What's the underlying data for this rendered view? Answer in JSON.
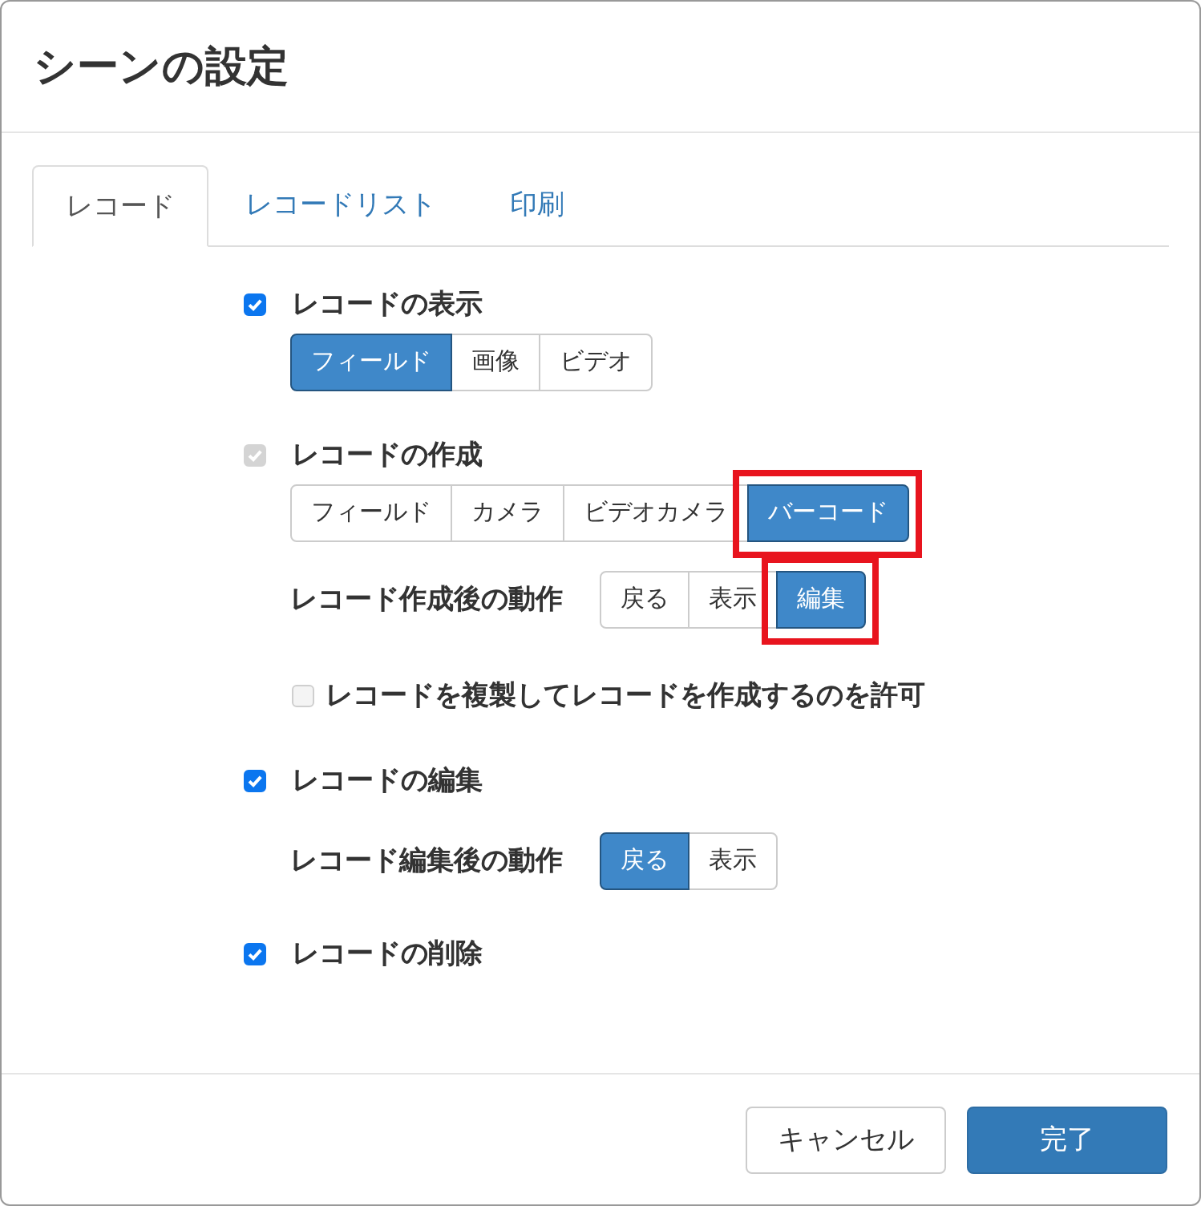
{
  "dialog": {
    "title": "シーンの設定"
  },
  "tabs": [
    {
      "label": "レコード",
      "selected": true
    },
    {
      "label": "レコードリスト",
      "selected": false
    },
    {
      "label": "印刷",
      "selected": false
    }
  ],
  "rows": [
    {
      "kind": "checkbox",
      "label": "レコードの表示",
      "checked": true,
      "disabled": false
    },
    {
      "kind": "buttons",
      "options": [
        {
          "label": "フィールド",
          "selected": true,
          "highlighted": false
        },
        {
          "label": "画像",
          "selected": false,
          "highlighted": false
        },
        {
          "label": "ビデオ",
          "selected": false,
          "highlighted": false
        }
      ]
    },
    {
      "kind": "checkbox",
      "label": "レコードの作成",
      "checked": true,
      "disabled": true
    },
    {
      "kind": "buttons",
      "options": [
        {
          "label": "フィールド",
          "selected": false,
          "highlighted": false
        },
        {
          "label": "カメラ",
          "selected": false,
          "highlighted": false
        },
        {
          "label": "ビデオカメラ",
          "selected": false,
          "highlighted": false
        },
        {
          "label": "バーコード",
          "selected": true,
          "highlighted": true
        }
      ]
    },
    {
      "kind": "action",
      "label": "レコード作成後の動作",
      "options": [
        {
          "label": "戻る",
          "selected": false,
          "highlighted": false
        },
        {
          "label": "表示",
          "selected": false,
          "highlighted": false
        },
        {
          "label": "編集",
          "selected": true,
          "highlighted": true
        }
      ]
    },
    {
      "kind": "subcheckbox",
      "label": "レコードを複製してレコードを作成するのを許可",
      "checked": false,
      "disabled": true
    },
    {
      "kind": "checkbox",
      "label": "レコードの編集",
      "checked": true,
      "disabled": false
    },
    {
      "kind": "action",
      "label": "レコード編集後の動作",
      "options": [
        {
          "label": "戻る",
          "selected": true,
          "highlighted": false
        },
        {
          "label": "表示",
          "selected": false,
          "highlighted": false
        }
      ]
    },
    {
      "kind": "checkbox",
      "label": "レコードの削除",
      "checked": true,
      "disabled": false
    }
  ],
  "footer": {
    "cancel": "キャンセル",
    "done": "完了"
  }
}
